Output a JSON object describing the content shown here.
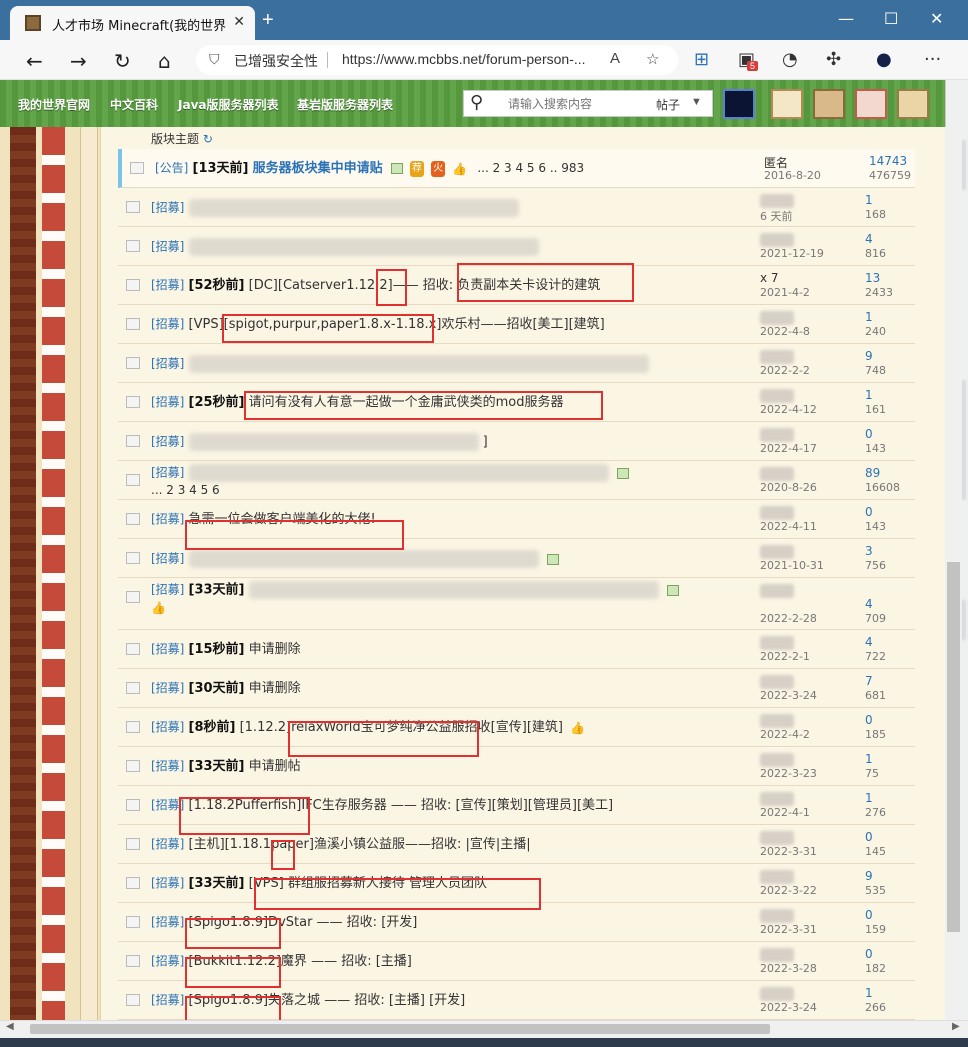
{
  "browser": {
    "tab_title": "人才市场 Minecraft(我的世界)中",
    "tab_close": "✕",
    "new_tab": "+",
    "minimize": "—",
    "maximize": "☐",
    "close": "✕",
    "security_label": "已增强安全性",
    "url": "https://www.mcbbs.net/forum-person-...",
    "extension_badge": "5"
  },
  "site_nav": {
    "links": [
      "我的世界官网",
      "中文百科",
      "Java版服务器列表",
      "基岩版服务器列表"
    ],
    "search_placeholder": "请输入搜索内容",
    "search_type": "帖子",
    "search_caret": "▼"
  },
  "section": {
    "title": "版块主题",
    "refresh_icon": "↻"
  },
  "threads": [
    {
      "category": "[公告]",
      "age": "[13天前]",
      "title": "服务器板块集中申请贴",
      "pages": "... 2 3 4 5 6 .. 983",
      "author": "匿名",
      "date": "2016-8-20",
      "replies": "14743",
      "views": "476759"
    },
    {
      "category": "[招募]",
      "age": "",
      "title": "",
      "pages": "",
      "author": "",
      "date": "6 天前",
      "replies": "1",
      "views": "168"
    },
    {
      "category": "[招募]",
      "age": "",
      "title": "",
      "pages": "",
      "author": "",
      "date": "2021-12-19",
      "replies": "4",
      "views": "816"
    },
    {
      "category": "[招募]",
      "age": "[52秒前]",
      "title": "[DC][Catserver1.12.2]—— 招收: 负责副本关卡设计的建筑",
      "pages": "",
      "author": "x 7",
      "date": "2021-4-2",
      "replies": "13",
      "views": "2433"
    },
    {
      "category": "[招募]",
      "age": "",
      "title": "[VPS][spigot,purpur,paper1.8.x-1.18.x]欢乐村——招收[美工][建筑]",
      "pages": "",
      "author": "",
      "date": "2022-4-8",
      "replies": "1",
      "views": "240"
    },
    {
      "category": "[招募]",
      "age": "",
      "title": "",
      "pages": "",
      "author": "",
      "date": "2022-2-2",
      "replies": "9",
      "views": "748"
    },
    {
      "category": "[招募]",
      "age": "[25秒前]",
      "title": "请问有没有人有意一起做一个金庸武侠类的mod服务器",
      "pages": "",
      "author": "",
      "date": "2022-4-12",
      "replies": "1",
      "views": "161"
    },
    {
      "category": "[招募]",
      "age": "",
      "title": "]",
      "pages": "",
      "author": "",
      "date": "2022-4-17",
      "replies": "0",
      "views": "143"
    },
    {
      "category": "[招募]",
      "age": "",
      "title": "",
      "pages": "... 2 3 4 5 6",
      "author": "",
      "date": "2020-8-26",
      "replies": "89",
      "views": "16608"
    },
    {
      "category": "[招募]",
      "age": "",
      "title": "急需一位会做客户端美化的大佬!",
      "pages": "",
      "author": "",
      "date": "2022-4-11",
      "replies": "0",
      "views": "143"
    },
    {
      "category": "[招募]",
      "age": "",
      "title": "",
      "pages": "",
      "author": "",
      "date": "2021-10-31",
      "replies": "3",
      "views": "756"
    },
    {
      "category": "[招募]",
      "age": "[33天前]",
      "title": "",
      "pages": "",
      "author": "",
      "date": "2022-2-28",
      "replies": "4",
      "views": "709"
    },
    {
      "category": "[招募]",
      "age": "[15秒前]",
      "title": "申请删除",
      "pages": "",
      "author": "",
      "date": "2022-2-1",
      "replies": "4",
      "views": "722"
    },
    {
      "category": "[招募]",
      "age": "[30天前]",
      "title": "申请删除",
      "pages": "",
      "author": "",
      "date": "2022-3-24",
      "replies": "7",
      "views": "681"
    },
    {
      "category": "[招募]",
      "age": "[8秒前]",
      "title": "[1.12.2]relaxWorld宝可梦纯净公益服招收[宣传][建筑]",
      "pages": "",
      "author": "",
      "date": "2022-4-2",
      "replies": "0",
      "views": "185"
    },
    {
      "category": "[招募]",
      "age": "[33天前]",
      "title": "申请删帖",
      "pages": "",
      "author": "",
      "date": "2022-3-23",
      "replies": "1",
      "views": "75"
    },
    {
      "category": "[招募]",
      "age": "",
      "title": "[1.18.2Pufferfish]IFC生存服务器 —— 招收: [宣传][策划][管理员][美工]",
      "pages": "",
      "author": "",
      "date": "2022-4-1",
      "replies": "1",
      "views": "276"
    },
    {
      "category": "[招募]",
      "age": "",
      "title": "[主机][1.18.1paper]渔溪小镇公益服——招收: |宣传|主播|",
      "pages": "",
      "author": "",
      "date": "2022-3-31",
      "replies": "0",
      "views": "145"
    },
    {
      "category": "[招募]",
      "age": "[33天前]",
      "title": "[VPS] 群组服招募新人接待 管理人员团队",
      "pages": "",
      "author": "",
      "date": "2022-3-22",
      "replies": "9",
      "views": "535"
    },
    {
      "category": "[招募]",
      "age": "",
      "title": "[Spigo1.8.9]DvStar —— 招收: [开发]",
      "pages": "",
      "author": "",
      "date": "2022-3-31",
      "replies": "0",
      "views": "159"
    },
    {
      "category": "[招募]",
      "age": "",
      "title": "[Bukkit1.12.2]魔界 —— 招收: [主播]",
      "pages": "",
      "author": "",
      "date": "2022-3-28",
      "replies": "0",
      "views": "182"
    },
    {
      "category": "[招募]",
      "age": "",
      "title": "[Spigo1.8.9]失落之城 —— 招收: [主播] [开发]",
      "pages": "",
      "author": "",
      "date": "2022-3-24",
      "replies": "1",
      "views": "266"
    }
  ],
  "tags": {
    "recommend": "荐",
    "hot": "火"
  },
  "colors": {
    "accent": "#2b73b6",
    "site_green": "#5aa041",
    "highlight": "#e03030",
    "titlebar": "#3a6f9e"
  }
}
